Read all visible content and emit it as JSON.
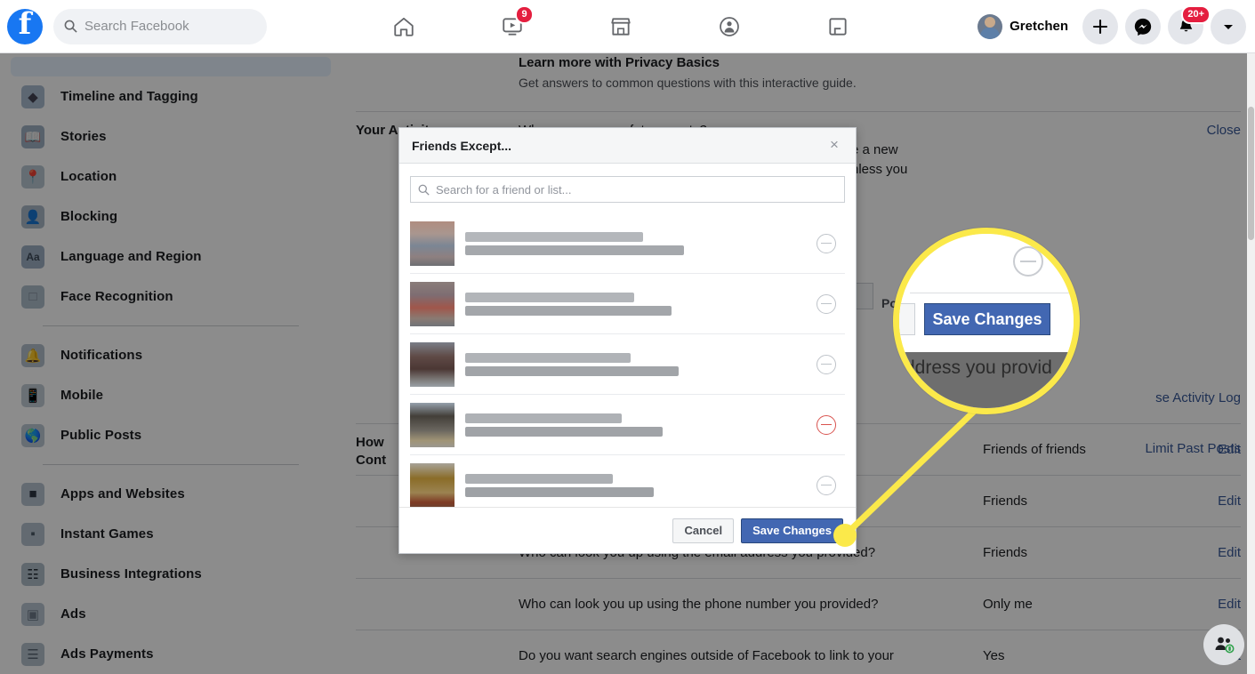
{
  "topbar": {
    "logo_letter": "f",
    "search": {
      "placeholder": "Search Facebook",
      "value": ""
    },
    "nav": [
      {
        "name": "home-icon",
        "label": "Home",
        "badge": ""
      },
      {
        "name": "watch-icon",
        "label": "Watch",
        "badge": "9"
      },
      {
        "name": "marketplace-icon",
        "label": "Marketplace",
        "badge": ""
      },
      {
        "name": "groups-icon",
        "label": "Groups",
        "badge": ""
      },
      {
        "name": "gaming-icon",
        "label": "Gaming",
        "badge": ""
      }
    ],
    "profile_name": "Gretchen",
    "create_label": "+",
    "messenger_label": "Messenger",
    "notifications_badge": "20+",
    "account_menu_label": "Account"
  },
  "sidebar": {
    "items": [
      {
        "label": "Timeline and Tagging",
        "icon": "tag-icon"
      },
      {
        "label": "Stories",
        "icon": "book-icon"
      },
      {
        "label": "Location",
        "icon": "pin-icon"
      },
      {
        "label": "Blocking",
        "icon": "block-user-icon"
      },
      {
        "label": "Language and Region",
        "icon": "language-icon"
      },
      {
        "label": "Face Recognition",
        "icon": "face-recognition-icon"
      },
      {
        "divider": true
      },
      {
        "label": "Notifications",
        "icon": "bell-icon"
      },
      {
        "label": "Mobile",
        "icon": "phone-icon"
      },
      {
        "label": "Public Posts",
        "icon": "globe-icon"
      },
      {
        "divider": true
      },
      {
        "label": "Apps and Websites",
        "icon": "cube-icon"
      },
      {
        "label": "Instant Games",
        "icon": "gamepad-icon"
      },
      {
        "label": "Business Integrations",
        "icon": "business-icon"
      },
      {
        "label": "Ads",
        "icon": "ads-icon"
      },
      {
        "label": "Ads Payments",
        "icon": "credit-card-icon"
      }
    ]
  },
  "main": {
    "privacy_basics_title": "Learn more with Privacy Basics",
    "privacy_basics_sub": "Get answers to common questions with this interactive guide.",
    "activity_section_label": "Your Activity",
    "activity_question": "Who can see your future posts?",
    "activity_desc_line1": "e a new",
    "activity_desc_line2": "nless you",
    "close_label": "Close",
    "post_chip": "Po",
    "use_activity_log": "se Activity Log",
    "limit_past_posts": "Limit Past Posts",
    "find_section_label_line1": "How",
    "find_section_label_line2": "Cont",
    "rows": [
      {
        "question": "",
        "value": "Friends of friends",
        "edit": "Edit"
      },
      {
        "question": "",
        "value": "Friends",
        "edit": "Edit"
      },
      {
        "question": "Who can look you up using the email address you provided?",
        "value": "Friends",
        "edit": "Edit"
      },
      {
        "question": "Who can look you up using the phone number you provided?",
        "value": "Only me",
        "edit": "Edit"
      },
      {
        "question": "Do you want search engines outside of Facebook to link to your",
        "value": "Yes",
        "edit": "Edit"
      }
    ]
  },
  "modal": {
    "title": "Friends Except...",
    "close_icon": "×",
    "search_placeholder": "Search for a friend or list...",
    "friends": [
      {
        "selected": false
      },
      {
        "selected": false
      },
      {
        "selected": false
      },
      {
        "selected": true
      },
      {
        "selected": false
      }
    ],
    "cancel_label": "Cancel",
    "save_label": "Save Changes"
  },
  "magnifier": {
    "save_label": "Save Changes",
    "background_text": "ddress you provid",
    "highlight_color": "#fbe94a"
  },
  "colors": {
    "brand_blue": "#1877f2",
    "button_blue": "#4267b2",
    "link_blue": "#385898",
    "badge_red": "#e41e3f",
    "remove_red": "#d9534f",
    "highlight_yellow": "#fbe94a"
  }
}
